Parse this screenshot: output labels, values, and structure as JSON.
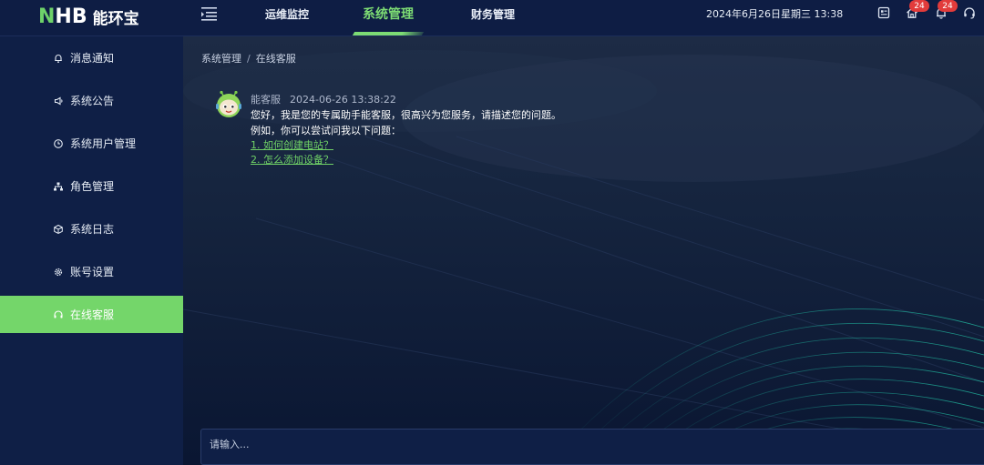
{
  "brand": {
    "logo_letters": "HB",
    "logo_n": "N",
    "name_cn": "能环宝"
  },
  "nav": {
    "items": [
      {
        "label": "运维监控"
      },
      {
        "label": "系统管理"
      },
      {
        "label": "财务管理"
      }
    ]
  },
  "header": {
    "datetime": "2024年6月26日星期三 13:38",
    "badges": {
      "home": "24",
      "bell": "24"
    }
  },
  "sidebar": {
    "items": [
      {
        "label": "消息通知",
        "icon": "bell-icon"
      },
      {
        "label": "系统公告",
        "icon": "megaphone-icon"
      },
      {
        "label": "系统用户管理",
        "icon": "user-clock-icon"
      },
      {
        "label": "角色管理",
        "icon": "org-chart-icon"
      },
      {
        "label": "系统日志",
        "icon": "cube-icon"
      },
      {
        "label": "账号设置",
        "icon": "gear-icon"
      },
      {
        "label": "在线客服",
        "icon": "headset-icon"
      }
    ],
    "active_index": 6
  },
  "breadcrumb": {
    "parent": "系统管理",
    "separator": "/",
    "current": "在线客服"
  },
  "chat": {
    "sender": "能客服",
    "time": "2024-06-26 13:38:22",
    "lines": [
      "您好，我是您的专属助手能客服，很高兴为您服务，请描述您的问题。",
      "例如，你可以尝试问我以下问题："
    ],
    "links": [
      "1. 如何创建电站？",
      "2. 怎么添加设备？"
    ]
  },
  "input": {
    "placeholder": "请输入..."
  },
  "colors": {
    "accent": "#74d66a",
    "badge": "#e23b3b",
    "sidebar_bg": "#0f1f46"
  }
}
